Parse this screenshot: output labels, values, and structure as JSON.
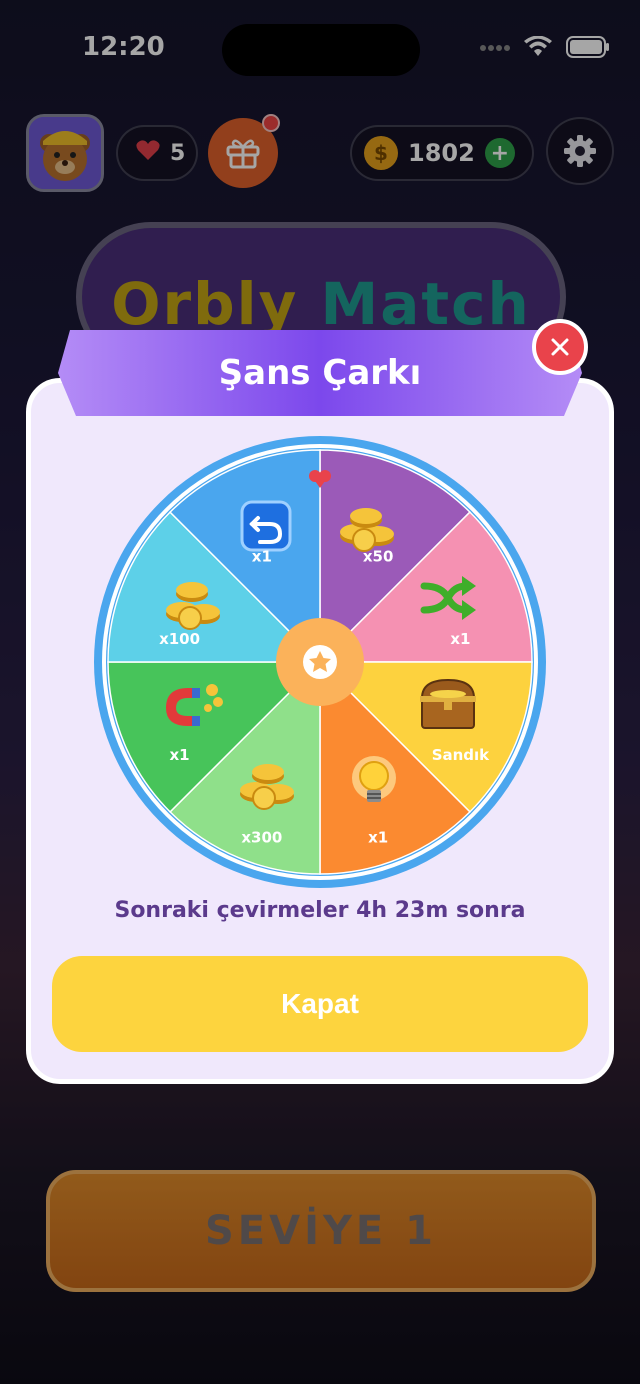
{
  "status_bar": {
    "time": "12:20"
  },
  "top_bar": {
    "lives": "5",
    "coins": "1802",
    "coin_symbol": "$",
    "plus_symbol": "+"
  },
  "title": {
    "part1": "Orbly",
    "part2": "Match"
  },
  "level_button": {
    "label": "SEVİYE 1"
  },
  "modal": {
    "title": "Şans Çarkı",
    "next_spin_text": "Sonraki çevirmeler 4h 23m sonra",
    "close_button_label": "Kapat",
    "wheel_segments": [
      {
        "label": "x50",
        "color": "#9b5ab8",
        "icon": "coins-icon"
      },
      {
        "label": "x1",
        "color": "#f591b2",
        "icon": "shuffle-icon"
      },
      {
        "label": "Sandık",
        "color": "#fdd23e",
        "icon": "treasure-chest-icon"
      },
      {
        "label": "x1",
        "color": "#fb8a30",
        "icon": "lightbulb-icon"
      },
      {
        "label": "x300",
        "color": "#8fe08a",
        "icon": "coins-icon"
      },
      {
        "label": "x1",
        "color": "#47c45a",
        "icon": "magnet-icon"
      },
      {
        "label": "x100",
        "color": "#5dd0e8",
        "icon": "coins-icon"
      },
      {
        "label": "x1",
        "color": "#4aa6ee",
        "icon": "undo-icon"
      }
    ]
  },
  "colors": {
    "modal_bg": "#f0e8fc",
    "ribbon": "#9a6cf0",
    "close_button": "#e9434b",
    "action_button": "#fdd43e",
    "wheel_rim": "#4aa6ee",
    "hub": "#fbb25a",
    "pointer": "#e9434b"
  }
}
